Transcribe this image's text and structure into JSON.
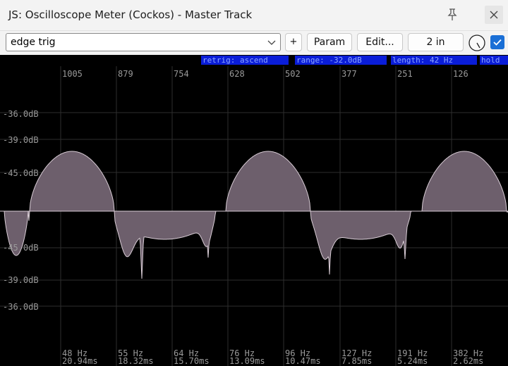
{
  "titlebar": {
    "title": "JS: Oscilloscope Meter (Cockos) - Master Track"
  },
  "toolbar": {
    "preset_value": "edge trig",
    "plus_label": "+",
    "param_label": "Param",
    "edit_label": "Edit...",
    "io_label": "2 in",
    "bypass_checked": true
  },
  "scope": {
    "status_items": [
      "retrig: ascend",
      "range: -32.0dB",
      "length: 42 Hz",
      "hold"
    ],
    "top_labels": [
      "1005",
      "879",
      "754",
      "628",
      "502",
      "377",
      "251",
      "126"
    ],
    "db_labels_upper": [
      "-36.0dB",
      "-39.0dB",
      "-45.0dB"
    ],
    "db_labels_lower": [
      "-45.0dB",
      "-39.0dB",
      "-36.0dB"
    ],
    "freq_labels": [
      "48 Hz",
      "55 Hz",
      "64 Hz",
      "76 Hz",
      "96 Hz",
      "127 Hz",
      "191 Hz",
      "382 Hz"
    ],
    "time_labels": [
      "20.94ms",
      "18.32ms",
      "15.70ms",
      "13.09ms",
      "10.47ms",
      "7.85ms",
      "5.24ms",
      "2.62ms"
    ]
  },
  "colors": {
    "background": "#000000",
    "grid": "#2e2e2e",
    "label": "#9a9a9a",
    "status_bg": "#0a1dd8",
    "status_text": "#8fa8ff",
    "wave_fill": "#6d5f6c",
    "wave_line": "#d9cdd6",
    "accent": "#1a6fd6"
  },
  "icons": {
    "pin": "pin-icon",
    "close": "close-icon",
    "chevron": "chevron-down-icon",
    "knob": "knob-icon",
    "check": "checkmark-icon"
  }
}
